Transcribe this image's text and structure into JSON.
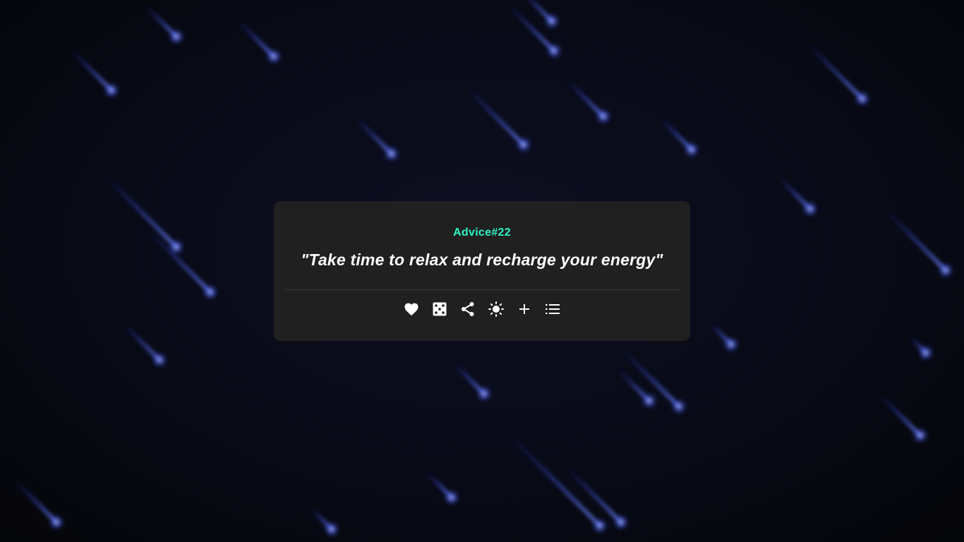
{
  "advice": {
    "id_label": "Advice#22",
    "text": "\"Take time to relax and recharge your energy\""
  },
  "actions": [
    {
      "icon": "heart-icon",
      "label": "Favorite"
    },
    {
      "icon": "dice-icon",
      "label": "Random advice"
    },
    {
      "icon": "share-icon",
      "label": "Share"
    },
    {
      "icon": "sun-icon",
      "label": "Toggle theme"
    },
    {
      "icon": "plus-icon",
      "label": "Add"
    },
    {
      "icon": "list-icon",
      "label": "List"
    }
  ],
  "colors": {
    "accent": "#2ff5c6",
    "card": "#202020",
    "background": "#07080f",
    "meteor": "#4a63ff"
  }
}
